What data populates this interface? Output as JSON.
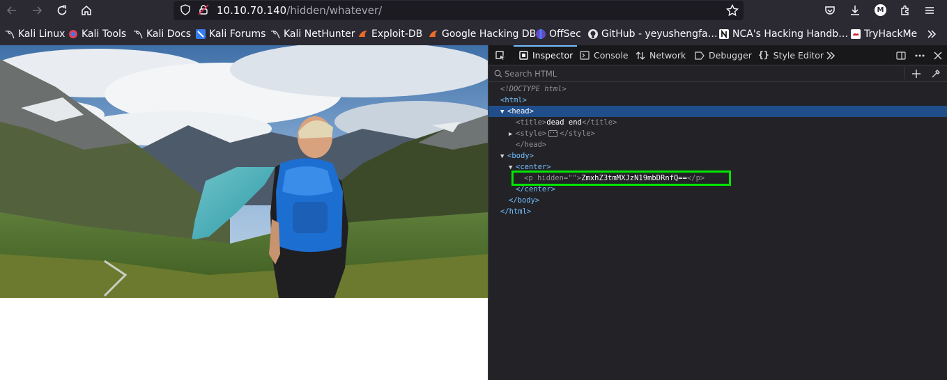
{
  "browser": {
    "url_host": "10.10.70.140",
    "url_path": "/hidden/whatever/",
    "profile_initial": "M",
    "accent": "#75bfff"
  },
  "bookmarks": [
    {
      "label": "Kali Linux",
      "icon": "kali-dragon-icon"
    },
    {
      "label": "Kali Tools",
      "icon": "kali-tools-icon"
    },
    {
      "label": "Kali Docs",
      "icon": "kali-dragon-icon"
    },
    {
      "label": "Kali Forums",
      "icon": "kali-forums-icon"
    },
    {
      "label": "Kali NetHunter",
      "icon": "kali-dragon-icon"
    },
    {
      "label": "Exploit-DB",
      "icon": "exploit-db-icon"
    },
    {
      "label": "Google Hacking DB",
      "icon": "exploit-db-icon"
    },
    {
      "label": "OffSec",
      "icon": "offsec-icon"
    },
    {
      "label": "GitHub - yeyushengfa…",
      "icon": "github-icon"
    },
    {
      "label": "NCA's Hacking Handb…",
      "icon": "notion-icon"
    },
    {
      "label": "TryHackMe",
      "icon": "tryhackme-icon"
    }
  ],
  "devtools": {
    "tabs": [
      "Inspector",
      "Console",
      "Network",
      "Debugger",
      "Style Editor"
    ],
    "search_placeholder": "Search HTML",
    "tree": {
      "doctype": "<!DOCTYPE html>",
      "html_open": "<html>",
      "head_open": "<head>",
      "title_open": "<title>",
      "title_text": "dead end",
      "title_close": "</title>",
      "style_open": "<style>",
      "style_close": "</style>",
      "head_close": "</head>",
      "body_open": "<body>",
      "center_open": "<center>",
      "p_tag": "<p",
      "p_attr": "hidden",
      "p_attr_val": "=\"\"",
      "p_gt": ">",
      "p_text": "ZmxhZ3tmMXJzN19mbDRnfQ==",
      "p_close": "</p>",
      "center_close": "</center>",
      "body_close": "</body>",
      "html_close": "</html>"
    }
  }
}
